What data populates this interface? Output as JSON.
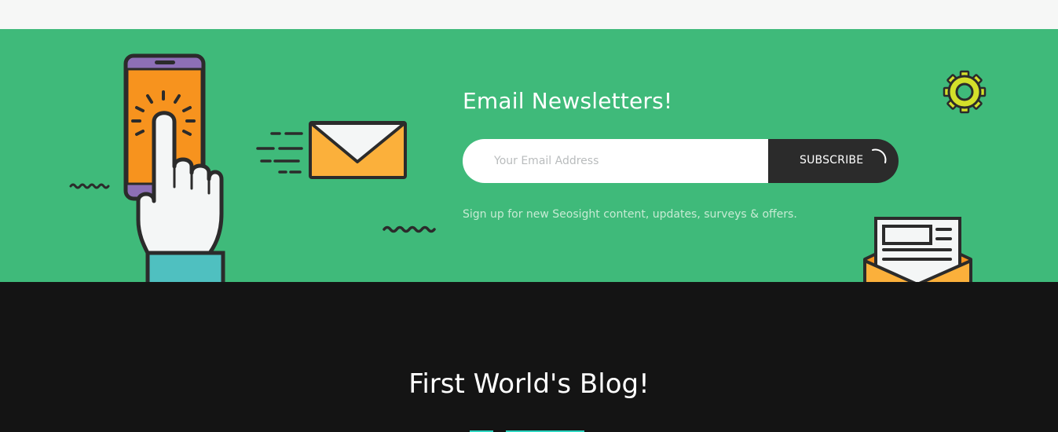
{
  "newsletter": {
    "title": "Email Newsletters!",
    "email_placeholder": "Your Email Address",
    "subscribe_label": "SUBSCRIBE",
    "hint": "Sign up for new Seosight content, updates, surveys & offers."
  },
  "blog": {
    "title": "First World's Blog!"
  },
  "colors": {
    "newsletter_bg": "#3fba7a",
    "blog_bg": "#141414",
    "button_bg": "#2b2b2b"
  }
}
